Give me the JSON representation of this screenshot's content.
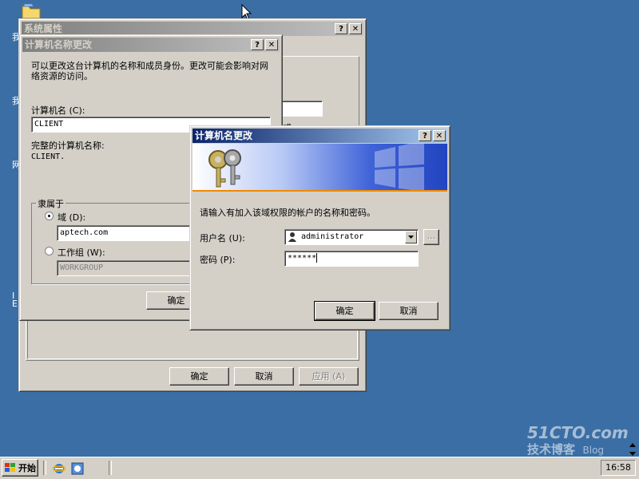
{
  "desktop": {
    "side_fragments": [
      "我",
      "我",
      "网",
      "I",
      "E"
    ]
  },
  "sysprops": {
    "title": "系统属性",
    "help": "?",
    "close": "✕",
    "ok": "确定",
    "cancel": "取消",
    "apply": "应用 (A)",
    "peek_label": "或"
  },
  "rename": {
    "title": "计算机名称更改",
    "help": "?",
    "close": "✕",
    "desc": "可以更改这台计算机的名称和成员身份。更改可能会影响对网络资源的访问。",
    "name_label": "计算机名 (C):",
    "name_value": "CLIENT",
    "full_label": "完整的计算机名称:",
    "full_value": "CLIENT.",
    "member_legend": "隶属于",
    "domain_label": "域 (D):",
    "domain_value": "aptech.com",
    "workgroup_label": "工作组 (W):",
    "workgroup_value": "WORKGROUP",
    "ok": "确定"
  },
  "cred": {
    "title": "计算机名更改",
    "help": "?",
    "close": "✕",
    "prompt": "请输入有加入该域权限的帐户的名称和密码。",
    "user_label": "用户名 (U):",
    "user_value": "administrator",
    "browse": "...",
    "pass_label": "密码 (P):",
    "pass_value": "******",
    "ok": "确定",
    "cancel": "取消"
  },
  "taskbar": {
    "start": "开始",
    "clock": "16:58"
  },
  "watermark": {
    "line1": "51CTO.com",
    "line2": "技术博客",
    "line3": "Blog"
  }
}
